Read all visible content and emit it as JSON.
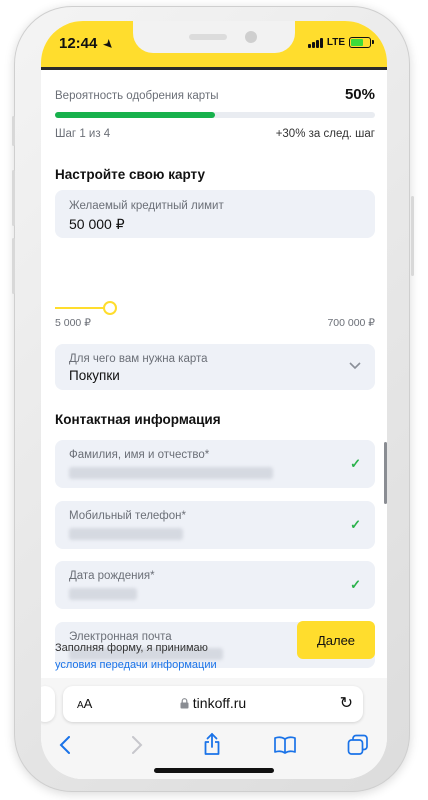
{
  "status_bar": {
    "time": "12:44",
    "network": "LTE"
  },
  "approval": {
    "label": "Вероятность одобрения карты",
    "percent_text": "50%",
    "progress": 0.5,
    "step_text": "Шаг 1 из 4",
    "next_step_bonus": "+30% за след. шаг"
  },
  "setup": {
    "title": "Настройте свою карту",
    "credit_limit": {
      "label": "Желаемый кредитный лимит",
      "value": "50 000 ₽",
      "min": "5 000 ₽",
      "max": "700 000 ₽"
    },
    "purpose": {
      "label": "Для чего вам нужна карта",
      "value": "Покупки"
    }
  },
  "contacts": {
    "title": "Контактная информация",
    "fields": [
      {
        "label": "Фамилия, имя и отчество*"
      },
      {
        "label": "Мобильный телефон*"
      },
      {
        "label": "Дата рождения*"
      },
      {
        "label": "Электронная почта"
      }
    ]
  },
  "consent": {
    "text": "Заполняя форму, я принимаю",
    "link": "условия передачи информации"
  },
  "next_button": "Далее",
  "browser": {
    "aa": "AA",
    "url": "tinkoff.ru"
  },
  "colors": {
    "accent": "#ffdd2d",
    "progress": "#17b14c",
    "link": "#1a73e8",
    "check": "#2bb24c"
  },
  "icons": {
    "location": "location-arrow-icon",
    "dropdown": "chevron-down-icon",
    "check": "check-icon",
    "lock": "lock-icon",
    "reload": "reload-icon",
    "back": "back-icon",
    "forward": "forward-icon",
    "share": "share-icon",
    "bookmarks": "bookmarks-icon",
    "tabs": "tabs-icon"
  }
}
